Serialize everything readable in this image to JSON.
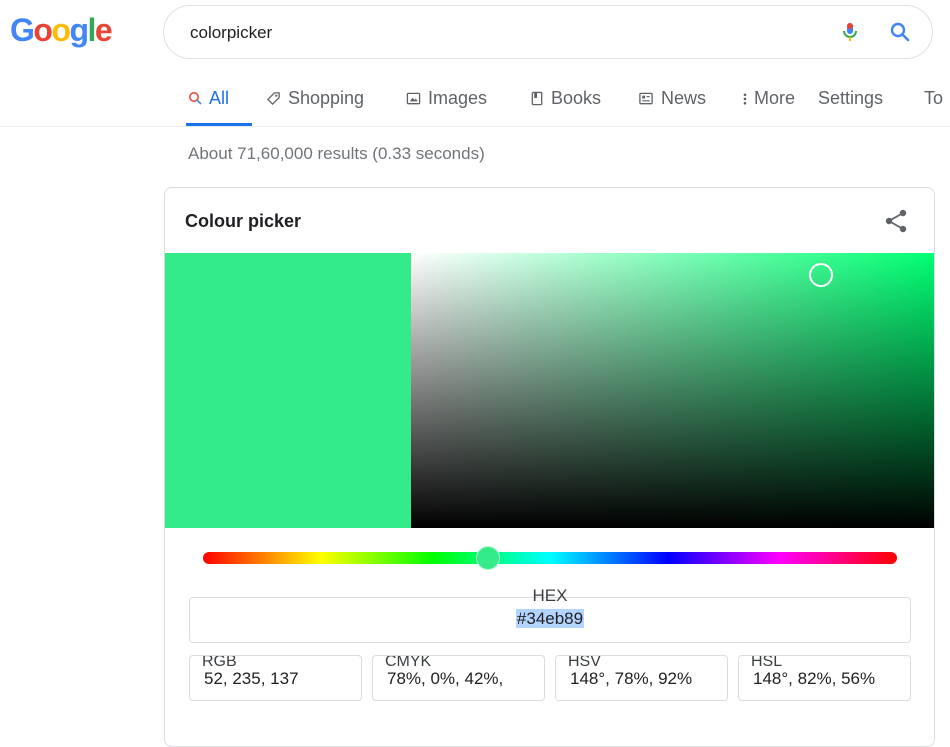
{
  "logo": {
    "letters": [
      "G",
      "o",
      "o",
      "g",
      "l",
      "e"
    ],
    "colors": [
      "#4285f4",
      "#ea4335",
      "#fbbc05",
      "#4285f4",
      "#34a853",
      "#ea4335"
    ]
  },
  "search": {
    "query": "colorpicker"
  },
  "tabs": [
    {
      "label": "All",
      "icon": "search-icon",
      "active": true
    },
    {
      "label": "Shopping",
      "icon": "tag-icon"
    },
    {
      "label": "Images",
      "icon": "image-icon"
    },
    {
      "label": "Books",
      "icon": "book-icon"
    },
    {
      "label": "News",
      "icon": "news-icon"
    },
    {
      "label": "More",
      "icon": "more-dots-icon"
    },
    {
      "label": "Settings"
    },
    {
      "label": "To"
    }
  ],
  "result_stats": "About 71,60,000 results (0.33 seconds)",
  "picker": {
    "title": "Colour picker",
    "current_color": "#34eb89",
    "hue_color": "#00ff73",
    "hue_degrees": 148,
    "saturation": 0.78,
    "value": 0.92,
    "hex": {
      "label": "HEX",
      "value": "#34eb89"
    },
    "fields": [
      {
        "label": "RGB",
        "value": "52, 235, 137"
      },
      {
        "label": "CMYK",
        "value": "78%, 0%, 42%,"
      },
      {
        "label": "HSV",
        "value": "148°, 78%, 92%"
      },
      {
        "label": "HSL",
        "value": "148°, 82%, 56%"
      }
    ]
  }
}
